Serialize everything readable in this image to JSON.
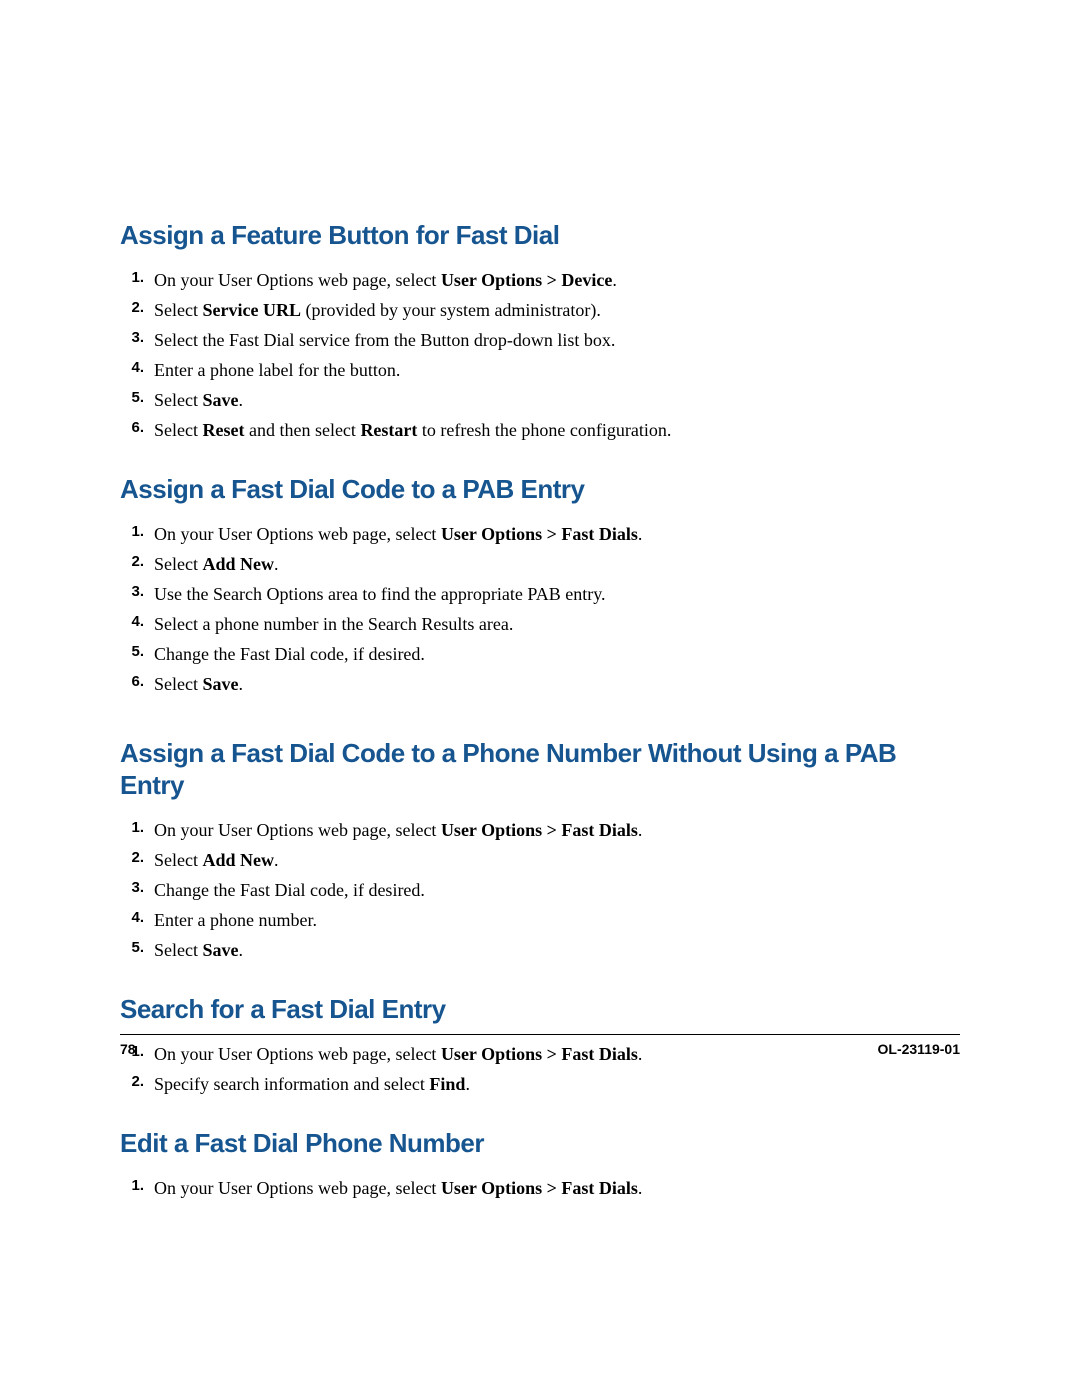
{
  "sections": [
    {
      "heading": "Assign a Feature Button for Fast Dial",
      "steps": [
        [
          {
            "t": "On your User Options web page, select "
          },
          {
            "t": "User Options > Device",
            "b": true
          },
          {
            "t": "."
          }
        ],
        [
          {
            "t": "Select "
          },
          {
            "t": "Service URL",
            "b": true
          },
          {
            "t": " (provided by your system administrator)."
          }
        ],
        [
          {
            "t": "Select the Fast Dial service from the Button drop-down list box."
          }
        ],
        [
          {
            "t": "Enter a phone label for the button."
          }
        ],
        [
          {
            "t": "Select "
          },
          {
            "t": "Save",
            "b": true
          },
          {
            "t": "."
          }
        ],
        [
          {
            "t": "Select "
          },
          {
            "t": "Reset",
            "b": true
          },
          {
            "t": " and then select "
          },
          {
            "t": "Restart",
            "b": true
          },
          {
            "t": " to refresh the phone configuration."
          }
        ]
      ]
    },
    {
      "heading": "Assign a Fast Dial Code to a PAB Entry",
      "steps": [
        [
          {
            "t": "On your User Options web page, select "
          },
          {
            "t": "User Options > Fast Dials",
            "b": true
          },
          {
            "t": "."
          }
        ],
        [
          {
            "t": "Select "
          },
          {
            "t": "Add New",
            "b": true
          },
          {
            "t": "."
          }
        ],
        [
          {
            "t": "Use the Search Options area to find the appropriate PAB entry."
          }
        ],
        [
          {
            "t": "Select a phone number in the Search Results area."
          }
        ],
        [
          {
            "t": "Change the Fast Dial code, if desired."
          }
        ],
        [
          {
            "t": "Select "
          },
          {
            "t": "Save",
            "b": true
          },
          {
            "t": "."
          }
        ]
      ]
    },
    {
      "heading": "Assign a Fast Dial Code to a Phone Number Without Using a PAB Entry",
      "steps": [
        [
          {
            "t": "On your User Options web page, select "
          },
          {
            "t": "User Options > Fast Dials",
            "b": true
          },
          {
            "t": "."
          }
        ],
        [
          {
            "t": "Select "
          },
          {
            "t": "Add New",
            "b": true
          },
          {
            "t": "."
          }
        ],
        [
          {
            "t": "Change the Fast Dial code, if desired."
          }
        ],
        [
          {
            "t": "Enter a phone number."
          }
        ],
        [
          {
            "t": "Select "
          },
          {
            "t": "Save",
            "b": true
          },
          {
            "t": "."
          }
        ]
      ]
    },
    {
      "heading": "Search for a Fast Dial Entry",
      "steps": [
        [
          {
            "t": "On your User Options web page, select "
          },
          {
            "t": "User Options > Fast Dials",
            "b": true
          },
          {
            "t": "."
          }
        ],
        [
          {
            "t": "Specify search information and select "
          },
          {
            "t": "Find",
            "b": true
          },
          {
            "t": "."
          }
        ]
      ]
    },
    {
      "heading": "Edit a Fast Dial Phone Number",
      "steps": [
        [
          {
            "t": "On your User Options web page, select "
          },
          {
            "t": "User Options > Fast Dials",
            "b": true
          },
          {
            "t": "."
          }
        ]
      ]
    }
  ],
  "footer": {
    "page_number": "78",
    "doc_id": "OL-23119-01"
  }
}
